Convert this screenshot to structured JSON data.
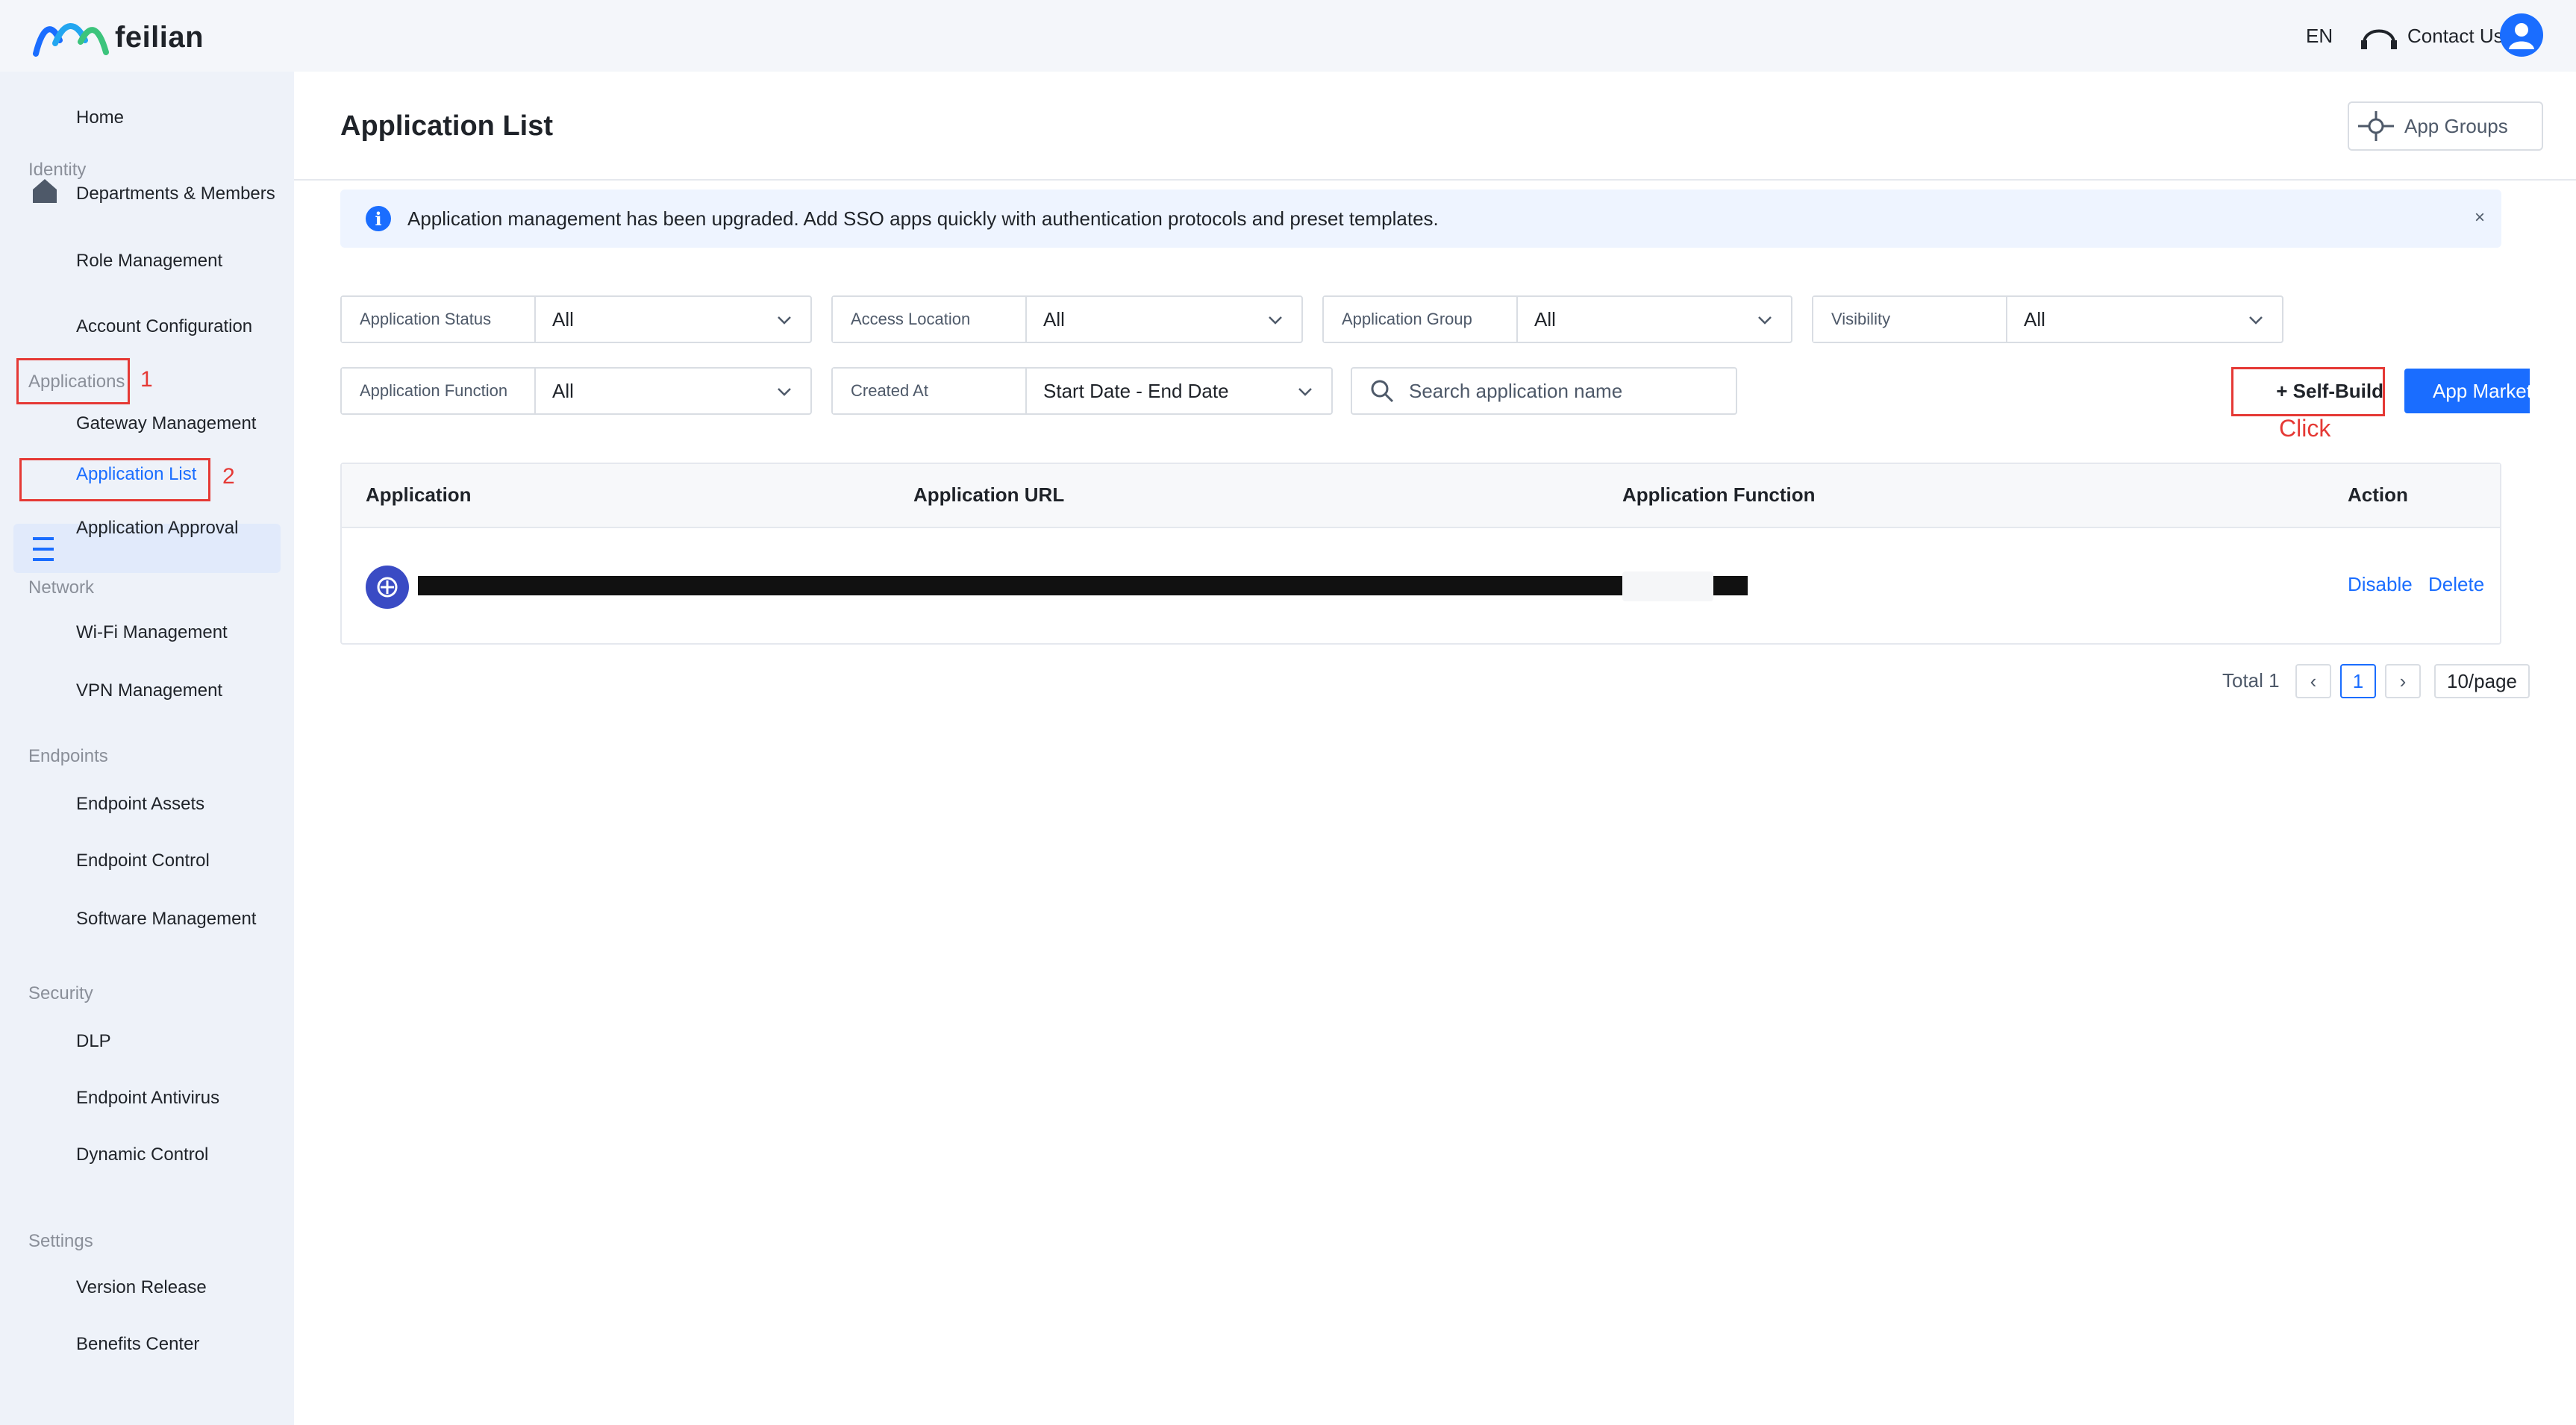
{
  "brand": {
    "name": "feilian"
  },
  "topbar": {
    "language": "EN",
    "contact": "Contact Us"
  },
  "sidebar": {
    "home": "Home",
    "groups": {
      "identity": "Identity",
      "applications": "Applications",
      "network": "Network",
      "endpoints": "Endpoints",
      "security": "Security",
      "settings": "Settings"
    },
    "items": {
      "departments": "Departments & Members",
      "role": "Role Management",
      "account": "Account Configuration",
      "gateway": "Gateway Management",
      "app_list": "Application List",
      "app_approval": "Application Approval",
      "wifi": "Wi-Fi Management",
      "vpn": "VPN Management",
      "endpoint_assets": "Endpoint Assets",
      "endpoint_control": "Endpoint Control",
      "software": "Software Management",
      "dlp": "DLP",
      "antivirus": "Endpoint Antivirus",
      "dynamic": "Dynamic Control",
      "version": "Version Release",
      "benefits": "Benefits Center"
    }
  },
  "annotations": {
    "step1": "1",
    "step2": "2",
    "click": "Click"
  },
  "page": {
    "title": "Application List",
    "app_groups": "App Groups"
  },
  "banner": {
    "icon": "i",
    "text": "Application management has been upgraded. Add SSO apps quickly with authentication protocols and preset templates.",
    "close": "×"
  },
  "filters": {
    "status": {
      "label": "Application Status",
      "value": "All"
    },
    "location": {
      "label": "Access Location",
      "value": "All"
    },
    "group": {
      "label": "Application Group",
      "value": "All"
    },
    "visibility": {
      "label": "Visibility",
      "value": "All"
    },
    "function": {
      "label": "Application Function",
      "value": "All"
    },
    "created": {
      "label": "Created At",
      "value": "Start Date - End Date"
    }
  },
  "search": {
    "placeholder": "Search application name"
  },
  "buttons": {
    "self_build": "+ Self-Build",
    "app_market": "App Market"
  },
  "table": {
    "headers": [
      "Application",
      "Application URL",
      "Application Function",
      "Action"
    ],
    "row": {
      "actions": [
        "Disable",
        "Delete"
      ]
    }
  },
  "pagination": {
    "total": "Total 1",
    "prev": "‹",
    "current": "1",
    "next": "›",
    "page_size": "10/page"
  },
  "colors": {
    "accent": "#1a6dff",
    "annotation": "#e53935",
    "sidebar_bg": "#eef2f9"
  }
}
